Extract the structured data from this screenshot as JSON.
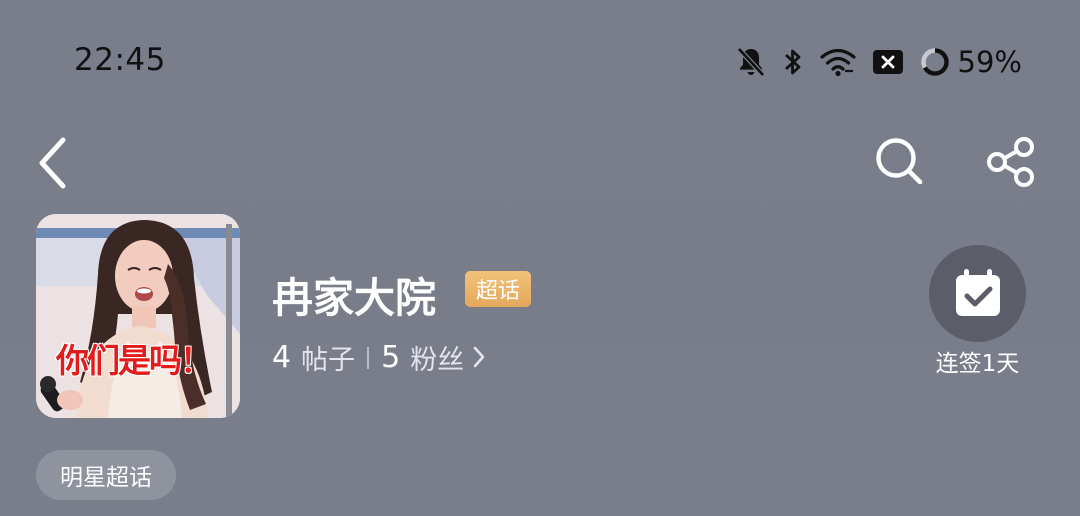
{
  "status_bar": {
    "time": "22:45",
    "battery_percent": "59%",
    "icons": [
      "bell-muted-icon",
      "bluetooth-icon",
      "wifi-icon",
      "sim-x-icon",
      "battery-ring-icon"
    ]
  },
  "nav": {
    "back_icon": "chevron-left-icon",
    "search_icon": "search-icon",
    "share_icon": "share-icon"
  },
  "header": {
    "avatar_caption": "你们是吗！",
    "title": "冉家大院",
    "badge": "超话",
    "badge_color": "#e6ad60",
    "posts_count": "4",
    "posts_label": "帖子",
    "fans_count": "5",
    "fans_label": "粉丝",
    "checkin_label": "连签1天"
  },
  "category_tag": "明星超话",
  "colors": {
    "background": "#797d8a",
    "checkin_circle": "#5b5e68",
    "tag_background": "#8f939e"
  }
}
